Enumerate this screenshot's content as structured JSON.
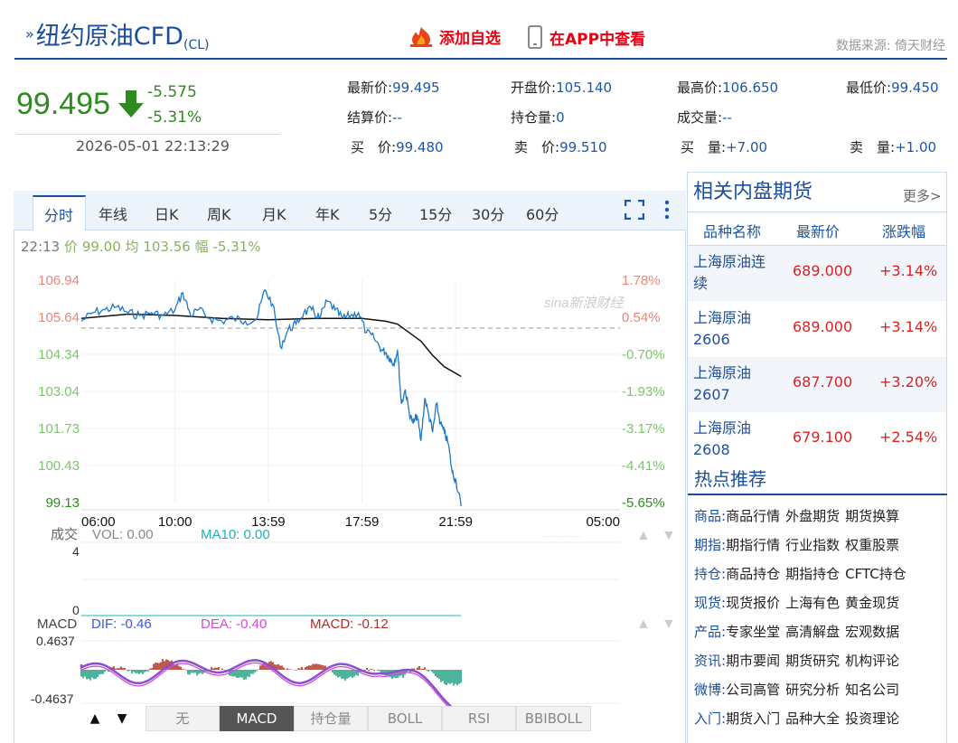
{
  "header": {
    "title": "纽约原油CFD",
    "code": "(CL)",
    "add_watchlist": "添加自选",
    "view_in_app": "在APP中查看",
    "data_source": "数据来源: 倚天财经"
  },
  "quote": {
    "price": "99.495",
    "change": "-5.575",
    "change_pct": "-5.31%",
    "datetime": "2026-05-01 22:13:29"
  },
  "stats": [
    {
      "label": "最新价:",
      "value": "99.495"
    },
    {
      "label": "开盘价:",
      "value": "105.140"
    },
    {
      "label": "最高价:",
      "value": "106.650"
    },
    {
      "label": "最低价:",
      "value": "99.450"
    },
    {
      "label": "结算价:",
      "value": "--"
    },
    {
      "label": "持仓量:",
      "value": "0"
    },
    {
      "label": "成交量:",
      "value": "--"
    },
    {
      "label": "买　价:",
      "value": "99.480"
    },
    {
      "label": "卖　价:",
      "value": "99.510"
    },
    {
      "label": "买　量:",
      "value": "+7.00"
    },
    {
      "label": "卖　量:",
      "value": "+1.00"
    }
  ],
  "chart_tabs": [
    "分时",
    "年线",
    "日K",
    "周K",
    "月K",
    "年K",
    "5分",
    "15分",
    "30分",
    "60分"
  ],
  "chart_info": {
    "time": "22:13",
    "price_label": "价",
    "price": "99.00",
    "avg_label": "均",
    "avg": "103.56",
    "amp_label": "幅",
    "amp": "-5.31%"
  },
  "watermark": "sina新浪财经",
  "chart_data": {
    "type": "line",
    "price_ticks": [
      "106.94",
      "105.64",
      "104.34",
      "103.04",
      "101.73",
      "100.43",
      "99.13"
    ],
    "pct_ticks": [
      "1.78%",
      "0.54%",
      "-0.70%",
      "-1.93%",
      "-3.17%",
      "-4.41%",
      "-5.65%"
    ],
    "x_ticks": [
      "06:00",
      "10:00",
      "13:59",
      "17:59",
      "21:59",
      "05:00"
    ],
    "ylim": [
      99.13,
      106.94
    ],
    "prev_settle": 105.07,
    "series": [
      {
        "x": [
          "06:00",
          "06:30",
          "07:00",
          "07:30",
          "08:00",
          "08:30",
          "09:00",
          "09:30",
          "10:00",
          "10:20",
          "10:40",
          "11:00",
          "11:30",
          "12:00",
          "12:30",
          "13:00",
          "13:30",
          "13:50",
          "14:10",
          "14:30",
          "14:50",
          "15:10",
          "15:30",
          "15:50",
          "16:10",
          "16:30",
          "16:50",
          "17:10",
          "17:30",
          "17:50",
          "18:10",
          "18:30",
          "18:50",
          "19:00",
          "19:10",
          "19:20",
          "19:30",
          "19:40",
          "19:50",
          "20:00",
          "20:10",
          "20:20",
          "20:30",
          "20:40",
          "20:50",
          "21:00",
          "21:10",
          "21:20",
          "21:30",
          "21:40",
          "21:50",
          "22:00",
          "22:13"
        ],
        "values": [
          105.5,
          105.8,
          105.9,
          106.0,
          105.8,
          105.7,
          105.8,
          105.7,
          105.9,
          106.5,
          105.7,
          105.9,
          105.6,
          105.5,
          105.6,
          105.5,
          105.6,
          106.6,
          106.1,
          104.6,
          105.2,
          105.4,
          105.8,
          105.9,
          105.6,
          106.2,
          105.9,
          105.6,
          105.7,
          105.8,
          105.1,
          104.9,
          104.5,
          104.4,
          104.2,
          104.0,
          104.5,
          102.6,
          103.1,
          102.3,
          101.9,
          102.2,
          101.3,
          102.8,
          102.2,
          101.6,
          102.6,
          101.9,
          101.6,
          101.2,
          100.2,
          99.9,
          99.0
        ]
      },
      {
        "x": [
          "06:00",
          "08:00",
          "10:00",
          "12:00",
          "13:59",
          "16:00",
          "17:59",
          "19:00",
          "19:30",
          "20:00",
          "20:30",
          "21:00",
          "21:30",
          "22:13"
        ],
        "values": [
          105.6,
          105.75,
          105.7,
          105.6,
          105.55,
          105.6,
          105.6,
          105.5,
          105.4,
          105.1,
          104.8,
          104.3,
          103.9,
          103.56
        ]
      }
    ]
  },
  "volume": {
    "label": "成交",
    "vol": "VOL: 0.00",
    "ma10": "MA10: 0.00",
    "ticks": [
      "4",
      "0"
    ]
  },
  "macd": {
    "label": "MACD",
    "dif": "DIF: -0.46",
    "dea": "DEA: -0.40",
    "macd": "MACD: -0.12",
    "ticks": [
      "0.4637",
      "-0.4637"
    ]
  },
  "indicator_buttons": [
    "无",
    "MACD",
    "持仓量",
    "BOLL",
    "RSI",
    "BBIBOLL"
  ],
  "sidebar": {
    "title": "相关内盘期货",
    "more": "更多>",
    "headers": [
      "品种名称",
      "最新价",
      "涨跌幅"
    ],
    "rows": [
      {
        "name": "上海原油连续",
        "price": "689.000",
        "change": "+3.14%"
      },
      {
        "name": "上海原油2606",
        "price": "689.000",
        "change": "+3.14%"
      },
      {
        "name": "上海原油2607",
        "price": "687.700",
        "change": "+3.20%"
      },
      {
        "name": "上海原油2608",
        "price": "679.100",
        "change": "+2.54%"
      }
    ],
    "hot_title": "热点推荐",
    "hot": [
      {
        "key": "商品:",
        "items": [
          "商品行情",
          "外盘期货",
          "期货换算"
        ]
      },
      {
        "key": "期指:",
        "items": [
          "期指行情",
          "行业指数",
          "权重股票"
        ]
      },
      {
        "key": "持仓:",
        "items": [
          "商品持仓",
          "期指持仓",
          "CFTC持仓"
        ]
      },
      {
        "key": "现货:",
        "items": [
          "现货报价",
          "上海有色",
          "黄金现货"
        ]
      },
      {
        "key": "产品:",
        "items": [
          "专家坐堂",
          "高清解盘",
          "宏观数据"
        ]
      },
      {
        "key": "资讯:",
        "items": [
          "期市要闻",
          "期货研究",
          "机构评论"
        ]
      },
      {
        "key": "微博:",
        "items": [
          "公司高管",
          "研究分析",
          "知名公司"
        ]
      },
      {
        "key": "入门:",
        "items": [
          "期货入门",
          "品种大全",
          "投资理论"
        ]
      }
    ]
  },
  "colors": {
    "brand": "#1c4e9c",
    "down": "#2e8b1f",
    "up": "#e02020",
    "price_line": "#1e78c8",
    "avg_line": "#111111",
    "dif_line": "#3c5ad6",
    "dea_line": "#d24bd8",
    "macd_pos": "#b03020",
    "macd_neg": "#20a080"
  }
}
